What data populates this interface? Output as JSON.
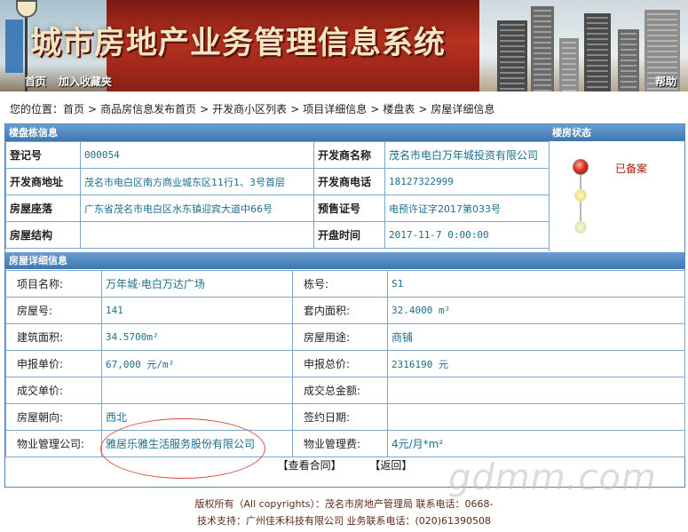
{
  "banner": {
    "title": "城市房地产业务管理信息系统",
    "home_link": "首页",
    "favorite_link": "加入收藏夹",
    "help_link": "帮助"
  },
  "breadcrumb": {
    "prefix": "您的位置：",
    "items": [
      "首页",
      "商品房信息发布首页",
      "开发商小区列表",
      "项目详细信息",
      "楼盘表",
      "房屋详细信息"
    ],
    "separator": ">"
  },
  "building_info": {
    "section_title": "楼盘栋信息",
    "rows": [
      {
        "k1": "登记号",
        "v1": "000054",
        "k2": "开发商名称",
        "v2": "茂名市电白万年城投资有限公司"
      },
      {
        "k1": "开发商地址",
        "v1": "茂名市电白区南方商业城东区11行1、3号首层",
        "k2": "开发商电话",
        "v2": "18127322999"
      },
      {
        "k1": "房屋座落",
        "v1": "广东省茂名市电白区水东镇迎宾大道中66号",
        "k2": "预售证号",
        "v2": "电预许证字2017第033号"
      },
      {
        "k1": "房屋结构",
        "v1": "",
        "k2": "开盘时间",
        "v2": "2017-11-7 0:00:00"
      }
    ]
  },
  "status": {
    "section_title": "楼房状态",
    "text": "已备案"
  },
  "house_detail": {
    "section_title": "房屋详细信息",
    "rows": [
      {
        "k1": "项目名称:",
        "v1": "万年城·电白万达广场",
        "k2": "栋号:",
        "v2": "S1"
      },
      {
        "k1": "房屋号:",
        "v1": "141",
        "k2": "套内面积:",
        "v2": "32.4000 m²"
      },
      {
        "k1": "建筑面积:",
        "v1": "34.5700m²",
        "k2": "房屋用途:",
        "v2": "商铺"
      },
      {
        "k1": "申报单价:",
        "v1": "67,000 元/m²",
        "k2": "申报总价:",
        "v2": "2316190 元"
      },
      {
        "k1": "成交单价:",
        "v1": "",
        "k2": "成交总金额:",
        "v2": ""
      },
      {
        "k1": "房屋朝向:",
        "v1": "西北",
        "k2": "签约日期:",
        "v2": ""
      },
      {
        "k1": "物业管理公司:",
        "v1": "雅居乐雅生活服务股份有限公司",
        "k2": "物业管理费:",
        "v2": "4元/月*m²"
      }
    ]
  },
  "actions": {
    "view_contract": "【查看合同】",
    "back": "【返回】"
  },
  "watermark": "gdmm.com",
  "footer": {
    "line1": "版权所有（All copyrights）：茂名市房地产管理局 联系电话：0668-",
    "line2": "技术支持：广州佳禾科技有限公司    业务联系电话：(020)61390508"
  },
  "colors": {
    "section_header": "#3e76b0",
    "value_text": "#1c6e8c",
    "status_text": "#b0180e",
    "annotation_oval": "#e04848"
  }
}
